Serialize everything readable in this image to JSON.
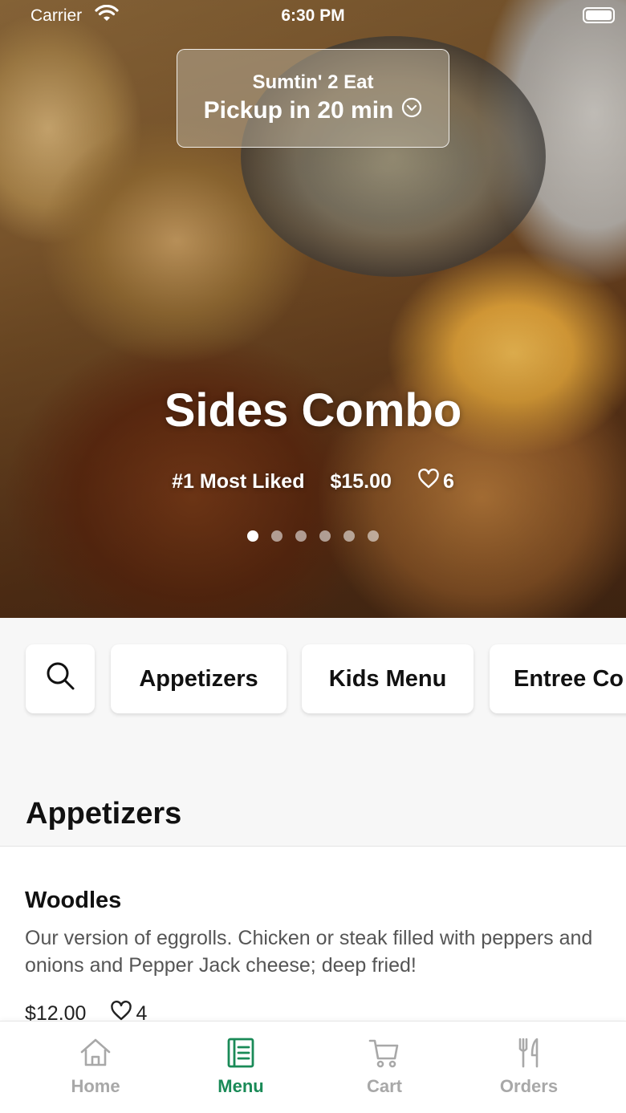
{
  "status_bar": {
    "carrier": "Carrier",
    "time": "6:30 PM"
  },
  "pickup": {
    "restaurant": "Sumtin' 2 Eat",
    "label": "Pickup in 20 min"
  },
  "featured": {
    "title": "Sides Combo",
    "badge": "#1 Most Liked",
    "price": "$15.00",
    "likes": "6",
    "slide_count": 6,
    "active_slide": 1
  },
  "categories": {
    "items": [
      "Appetizers",
      "Kids Menu",
      "Entree Co"
    ]
  },
  "section": {
    "title": "Appetizers"
  },
  "item": {
    "name": "Woodles",
    "description": "Our version of eggrolls. Chicken or steak filled with peppers and onions and Pepper Jack cheese; deep fried!",
    "price": "$12.00",
    "likes": "4"
  },
  "tabs": [
    "Home",
    "Menu",
    "Cart",
    "Orders"
  ],
  "active_tab": "Menu",
  "colors": {
    "accent": "#1a8a57",
    "inactive": "#a8a8a8"
  }
}
